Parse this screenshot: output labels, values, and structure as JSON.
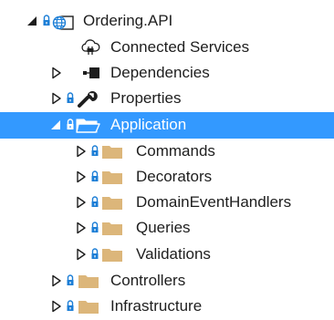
{
  "tree": {
    "root": {
      "label": "Ordering.API"
    },
    "connected_services": {
      "label": "Connected Services"
    },
    "dependencies": {
      "label": "Dependencies"
    },
    "properties": {
      "label": "Properties"
    },
    "application": {
      "label": "Application",
      "selected": true,
      "children": [
        {
          "label": "Commands"
        },
        {
          "label": "Decorators"
        },
        {
          "label": "DomainEventHandlers"
        },
        {
          "label": "Queries"
        },
        {
          "label": "Validations"
        }
      ]
    },
    "controllers": {
      "label": "Controllers"
    },
    "infrastructure": {
      "label": "Infrastructure"
    }
  },
  "colors": {
    "selection": "#3399ff",
    "folder": "#dcb67a",
    "lock": "#1c7ed6",
    "text": "#1e1e1e"
  }
}
